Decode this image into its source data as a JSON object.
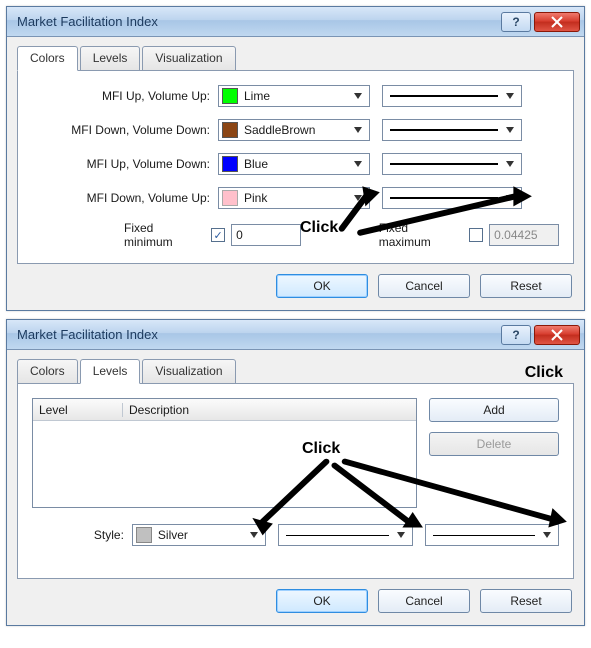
{
  "dialog1": {
    "title": "Market Facilitation Index",
    "help": "?",
    "tabs": {
      "colors": "Colors",
      "levels": "Levels",
      "visualization": "Visualization"
    },
    "rows": [
      {
        "label": "MFI Up, Volume Up:",
        "colorName": "Lime",
        "swatch": "#00ff00"
      },
      {
        "label": "MFI Down, Volume Down:",
        "colorName": "SaddleBrown",
        "swatch": "#8b4513"
      },
      {
        "label": "MFI Up, Volume Down:",
        "colorName": "Blue",
        "swatch": "#0000ff"
      },
      {
        "label": "MFI Down, Volume Up:",
        "colorName": "Pink",
        "swatch": "#ffc0cb"
      }
    ],
    "fixedMinLabel": "Fixed minimum",
    "fixedMinValue": "0",
    "fixedMaxLabel": "Fixed maximum",
    "fixedMaxValue": "0.04425",
    "buttons": {
      "ok": "OK",
      "cancel": "Cancel",
      "reset": "Reset"
    },
    "annotation": "Click"
  },
  "dialog2": {
    "title": "Market Facilitation Index",
    "help": "?",
    "tabs": {
      "colors": "Colors",
      "levels": "Levels",
      "visualization": "Visualization"
    },
    "grid": {
      "levelHeader": "Level",
      "descHeader": "Description"
    },
    "add": "Add",
    "delete": "Delete",
    "styleLabel": "Style:",
    "styleColorName": "Silver",
    "styleSwatch": "#c0c0c0",
    "buttons": {
      "ok": "OK",
      "cancel": "Cancel",
      "reset": "Reset"
    },
    "annotationTop": "Click",
    "annotationMid": "Click"
  }
}
